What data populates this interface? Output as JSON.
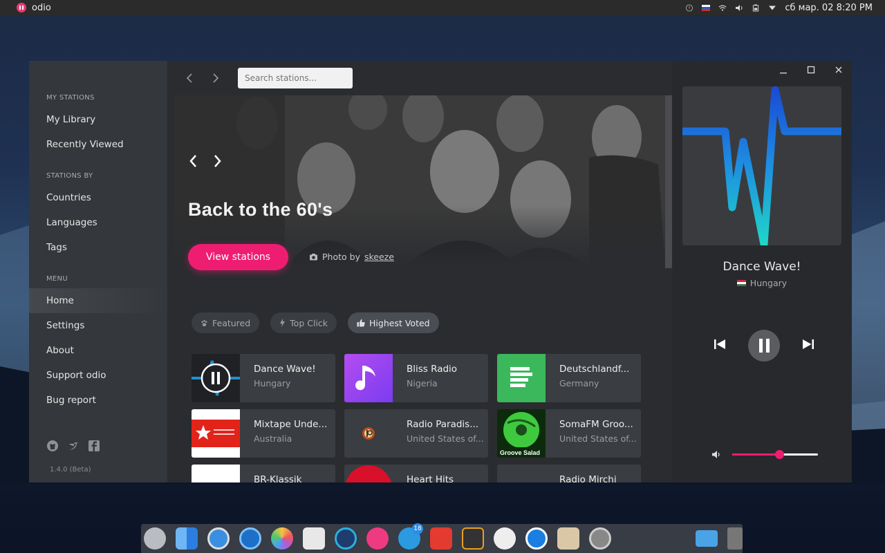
{
  "topbar": {
    "app_name": "odio",
    "datetime": "сб мар. 02 8:20 PM"
  },
  "sidebar": {
    "sections": [
      {
        "heading": "MY STATIONS",
        "items": [
          "My Library",
          "Recently Viewed"
        ]
      },
      {
        "heading": "STATIONS BY",
        "items": [
          "Countries",
          "Languages",
          "Tags"
        ]
      },
      {
        "heading": "MENU",
        "items": [
          "Home",
          "Settings",
          "About",
          "Support odio",
          "Bug report"
        ]
      }
    ],
    "active_item": "Home",
    "version": "1.4.0 (Beta)"
  },
  "toolbar": {
    "search_placeholder": "Search stations..."
  },
  "hero": {
    "title": "Back to the 60's",
    "button_label": "View stations",
    "photo_by_label": "Photo by",
    "photo_author": "skeeze"
  },
  "filters": [
    {
      "label": "Featured",
      "icon": "paw-icon"
    },
    {
      "label": "Top Click",
      "icon": "bolt-icon"
    },
    {
      "label": "Highest Voted",
      "icon": "thumbs-up-icon"
    }
  ],
  "active_filter": "Highest Voted",
  "stations": [
    {
      "name": "Dance Wave!",
      "country": "Hungary",
      "thumb": "dancewave",
      "playing": true
    },
    {
      "name": "Bliss Radio",
      "country": "Nigeria",
      "thumb": "bliss"
    },
    {
      "name": "Deutschlandf...",
      "country": "Germany",
      "thumb": "deutschland"
    },
    {
      "name": "Mixtape Unde...",
      "country": "Australia",
      "thumb": "mixtape"
    },
    {
      "name": "Radio Paradis...",
      "country": "United States of...",
      "thumb": "paradise"
    },
    {
      "name": "SomaFM Groo...",
      "country": "United States of...",
      "thumb": "soma"
    },
    {
      "name": "BR-Klassik",
      "country": "",
      "thumb": "br"
    },
    {
      "name": "Heart Hits",
      "country": "",
      "thumb": "heart"
    },
    {
      "name": "Radio Mirchi",
      "country": "",
      "thumb": "mirchi"
    }
  ],
  "player": {
    "station_name": "Dance Wave!",
    "country": "Hungary",
    "volume": 0.55
  },
  "colors": {
    "accent": "#ef1d72",
    "sidebar": "#34373b",
    "panel": "#28292c"
  },
  "dock": {
    "telegram_badge": "18"
  }
}
